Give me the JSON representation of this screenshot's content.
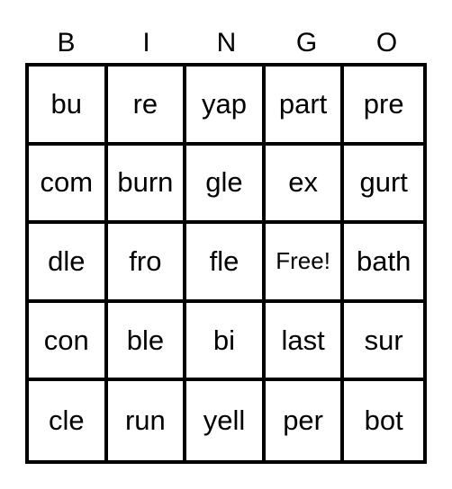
{
  "card": {
    "header": [
      "B",
      "I",
      "N",
      "G",
      "O"
    ],
    "rows": [
      [
        "bu",
        "re",
        "yap",
        "part",
        "pre"
      ],
      [
        "com",
        "burn",
        "gle",
        "ex",
        "gurt"
      ],
      [
        "dle",
        "fro",
        "fle",
        "Free!",
        "bath"
      ],
      [
        "con",
        "ble",
        "bi",
        "last",
        "sur"
      ],
      [
        "cle",
        "run",
        "yell",
        "per",
        "bot"
      ]
    ],
    "free_label": "Free!"
  }
}
